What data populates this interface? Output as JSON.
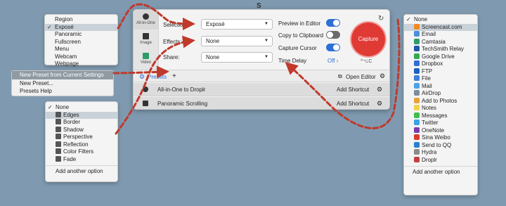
{
  "selection_menu": {
    "items": [
      {
        "label": "Region",
        "checked": false,
        "highlighted": false
      },
      {
        "label": "Exposé",
        "checked": true,
        "highlighted": false
      },
      {
        "label": "Panoramic",
        "checked": false,
        "highlighted": false
      },
      {
        "label": "Fullscreen",
        "checked": false,
        "highlighted": false
      },
      {
        "label": "Menu",
        "checked": false,
        "highlighted": false
      },
      {
        "label": "Webcam",
        "checked": false,
        "highlighted": false
      },
      {
        "label": "Webpage",
        "checked": false,
        "highlighted": false
      }
    ]
  },
  "preset_context_menu": {
    "items": [
      "New Preset from Current Settings",
      "New Preset...",
      "Presets Help"
    ]
  },
  "effects_menu": {
    "items": [
      {
        "label": "None",
        "checked": true,
        "icon": "none"
      },
      {
        "label": "Edges",
        "checked": false,
        "icon": "edges-icon"
      },
      {
        "label": "Border",
        "checked": false,
        "icon": "border-icon"
      },
      {
        "label": "Shadow",
        "checked": false,
        "icon": "shadow-icon"
      },
      {
        "label": "Perspective",
        "checked": false,
        "icon": "perspective-icon"
      },
      {
        "label": "Reflection",
        "checked": false,
        "icon": "reflection-icon"
      },
      {
        "label": "Color Filters",
        "checked": false,
        "icon": "color-filters-icon"
      },
      {
        "label": "Fade",
        "checked": false,
        "icon": "fade-icon"
      }
    ],
    "footer": "Add another option"
  },
  "share_menu": {
    "items": [
      {
        "label": "None",
        "checked": true,
        "color": "#ffffff"
      },
      {
        "label": "Screencast.com",
        "checked": false,
        "color": "#f08a24"
      },
      {
        "label": "Email",
        "checked": false,
        "color": "#4a90d9"
      },
      {
        "label": "Camtasia",
        "checked": false,
        "color": "#2e9b6a"
      },
      {
        "label": "TechSmith Relay",
        "checked": false,
        "color": "#1d5aa8"
      },
      {
        "label": "Google Drive",
        "checked": false,
        "color": "#34a853"
      },
      {
        "label": "Dropbox",
        "checked": false,
        "color": "#2f6fd6"
      },
      {
        "label": "FTP",
        "checked": false,
        "color": "#1b62c5"
      },
      {
        "label": "File",
        "checked": false,
        "color": "#3f7fd8"
      },
      {
        "label": "Mail",
        "checked": false,
        "color": "#4aa3e8"
      },
      {
        "label": "AirDrop",
        "checked": false,
        "color": "#7d8c9a"
      },
      {
        "label": "Add to Photos",
        "checked": false,
        "color": "#e8a23c"
      },
      {
        "label": "Notes",
        "checked": false,
        "color": "#f0d24a"
      },
      {
        "label": "Messages",
        "checked": false,
        "color": "#3fbf4f"
      },
      {
        "label": "Twitter",
        "checked": false,
        "color": "#39a3e6"
      },
      {
        "label": "OneNote",
        "checked": false,
        "color": "#7a3cab"
      },
      {
        "label": "Sina Weibo",
        "checked": false,
        "color": "#d93a2b"
      },
      {
        "label": "Send to QQ",
        "checked": false,
        "color": "#2a7fd2"
      },
      {
        "label": "Hydra",
        "checked": false,
        "color": "#8a8a8a"
      },
      {
        "label": "Droplr",
        "checked": false,
        "color": "#c43f3f"
      }
    ],
    "footer": "Add another option"
  },
  "panel": {
    "top_glyph": "S",
    "modes": [
      {
        "label": "All-in-One",
        "icon": "all-in-one-icon"
      },
      {
        "label": "Image",
        "icon": "camera-icon"
      },
      {
        "label": "Video",
        "icon": "video-camera-icon"
      }
    ],
    "selection": {
      "label": "Selection:",
      "value": "Exposé"
    },
    "effects": {
      "label": "Effects:",
      "value": "None"
    },
    "share": {
      "label": "Share:",
      "value": "None"
    },
    "options": {
      "preview_in_editor": {
        "label": "Preview in Editor",
        "on": true
      },
      "copy_to_clipboard": {
        "label": "Copy to Clipboard",
        "on": false
      },
      "capture_cursor": {
        "label": "Capture Cursor",
        "on": true
      },
      "time_delay": {
        "label": "Time Delay",
        "value": "Off"
      }
    },
    "capture_label": "Capture",
    "shortcut": "^⌥C",
    "presets_label": "Presets",
    "add_label": "+",
    "open_editor_label": "Open Editor",
    "presets": [
      {
        "name": "All-in-One to Droplr",
        "shortcut": "Add Shortcut",
        "icon": "all-in-one-icon"
      },
      {
        "name": "Panoramic Scrolling",
        "shortcut": "Add Shortcut",
        "icon": "camera-icon"
      }
    ]
  },
  "colors": {
    "background": "#7f9ab0",
    "accent": "#2d6fd6",
    "capture": "#e03a35",
    "arrow": "#c0392b"
  }
}
